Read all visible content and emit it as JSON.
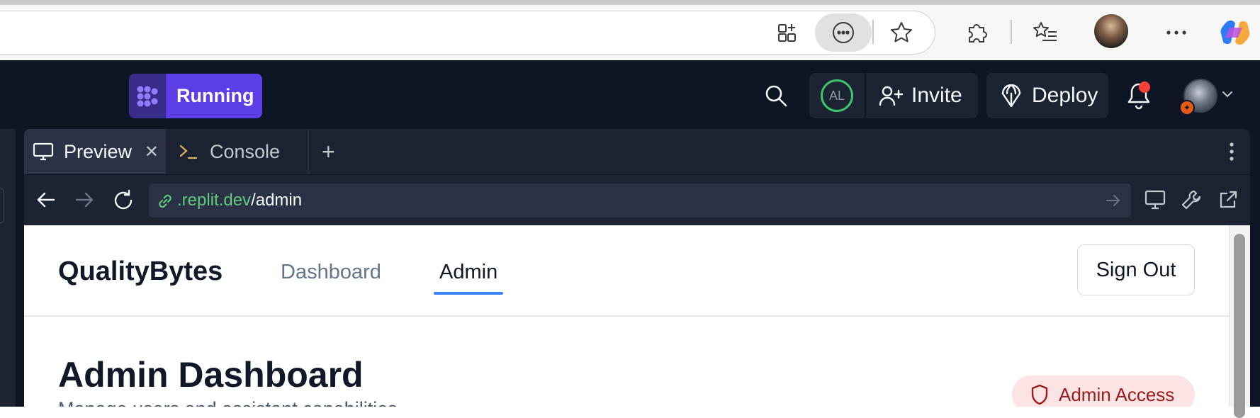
{
  "workspace": {
    "run_status": "Running",
    "collaborator_initials": "AL",
    "invite_label": "Invite",
    "deploy_label": "Deploy"
  },
  "tabs": [
    {
      "label": "Preview",
      "icon": "monitor-icon",
      "active": true
    },
    {
      "label": "Console",
      "icon": "terminal-icon",
      "active": false
    }
  ],
  "url": {
    "host": ".replit.dev",
    "path": "/admin"
  },
  "app": {
    "brand": "QualityBytes",
    "nav": {
      "dashboard": "Dashboard",
      "admin": "Admin"
    },
    "sign_out": "Sign Out",
    "page_title": "Admin Dashboard",
    "subtitle": "Manage users and assistant capabilities",
    "badge": "Admin Access"
  },
  "colors": {
    "workspace_bg": "#0e1525",
    "running_accent": "#5b3ee6",
    "url_host": "#5fc97c",
    "active_underline": "#3b82f6",
    "badge_bg": "#fde4e4",
    "badge_text": "#991b1b"
  }
}
